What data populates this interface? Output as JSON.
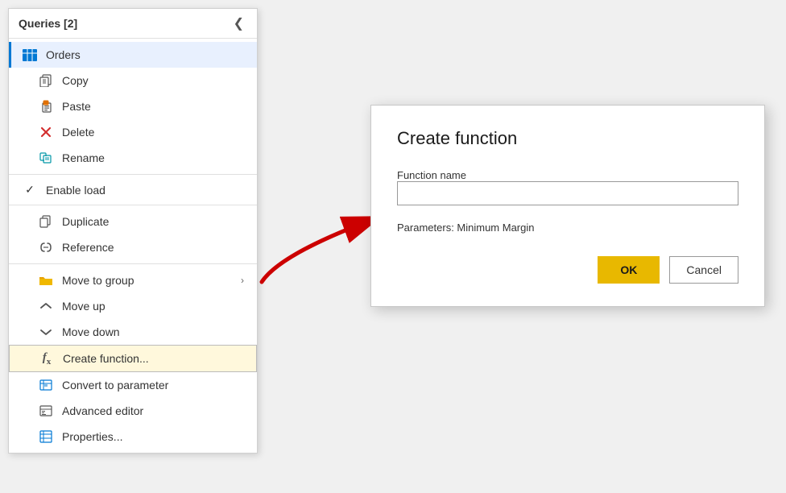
{
  "panel": {
    "title": "Queries [2]",
    "collapse_icon": "❮",
    "items": [
      {
        "id": "orders",
        "label": "Orders",
        "icon": "table",
        "type": "query",
        "active": true
      },
      {
        "id": "copy",
        "label": "Copy",
        "icon": "copy",
        "indent": true
      },
      {
        "id": "paste",
        "label": "Paste",
        "icon": "paste",
        "indent": true
      },
      {
        "id": "delete",
        "label": "Delete",
        "icon": "delete",
        "indent": true
      },
      {
        "id": "rename",
        "label": "Rename",
        "icon": "rename",
        "indent": true
      },
      {
        "id": "enable-load",
        "label": "Enable load",
        "icon": "check",
        "indent": true,
        "has_check": true
      },
      {
        "id": "duplicate",
        "label": "Duplicate",
        "icon": "duplicate",
        "indent": true
      },
      {
        "id": "reference",
        "label": "Reference",
        "icon": "reference",
        "indent": true
      },
      {
        "id": "move-to-group",
        "label": "Move to group",
        "icon": "folder",
        "indent": true,
        "has_arrow": true
      },
      {
        "id": "move-up",
        "label": "Move up",
        "icon": "move-up",
        "indent": true
      },
      {
        "id": "move-down",
        "label": "Move down",
        "icon": "move-down",
        "indent": true
      },
      {
        "id": "create-function",
        "label": "Create function...",
        "icon": "fx",
        "indent": true,
        "highlighted": true
      },
      {
        "id": "convert-to-parameter",
        "label": "Convert to parameter",
        "icon": "convert",
        "indent": true
      },
      {
        "id": "advanced-editor",
        "label": "Advanced editor",
        "icon": "advanced",
        "indent": true
      },
      {
        "id": "properties",
        "label": "Properties...",
        "icon": "properties",
        "indent": true
      }
    ]
  },
  "dialog": {
    "title": "Create function",
    "function_name_label": "Function name",
    "function_name_placeholder": "",
    "params_label": "Parameters: Minimum Margin",
    "ok_label": "OK",
    "cancel_label": "Cancel"
  }
}
